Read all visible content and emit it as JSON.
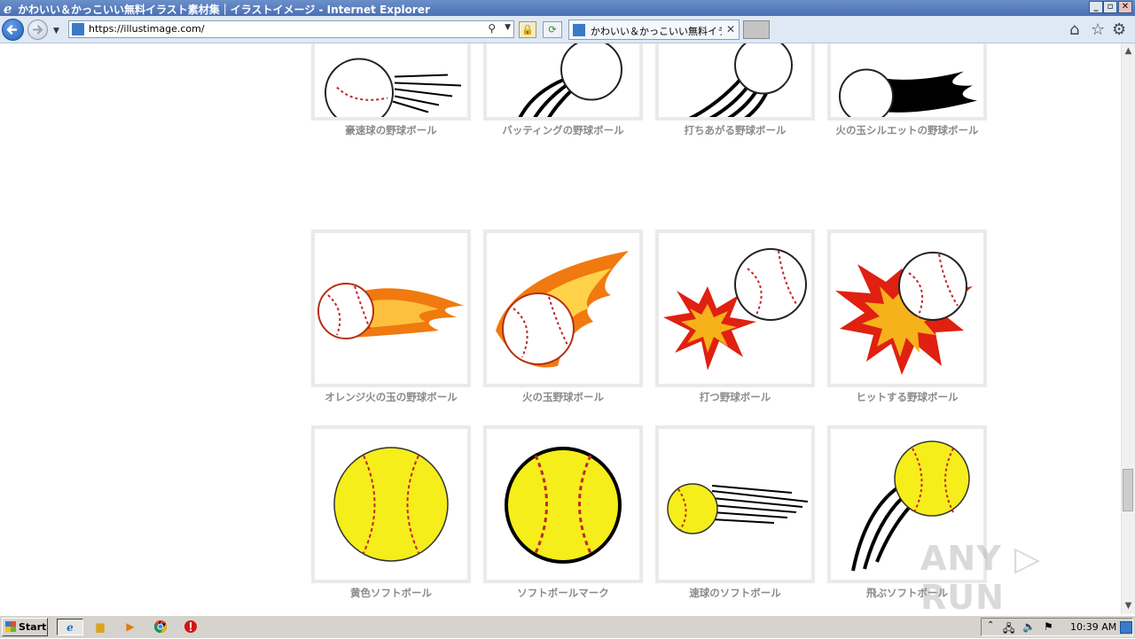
{
  "window": {
    "title": "かわいい＆かっこいい無料イラスト素材集｜イラストイメージ - Internet Explorer",
    "minimize_glyph": "_",
    "restore_glyph": "▫",
    "close_glyph": "✕"
  },
  "address_bar": {
    "url": "https://illustimage.com/"
  },
  "tab": {
    "label": "かわいい＆かっこいい無料イラ...",
    "close_glyph": "✕"
  },
  "toolbar_icons": [
    "home-icon",
    "favorites-star-icon",
    "gear-icon"
  ],
  "cards": [
    {
      "caption": "豪速球の野球ボール"
    },
    {
      "caption": "バッティングの野球ボール"
    },
    {
      "caption": "打ちあがる野球ボール"
    },
    {
      "caption": "火の玉シルエットの野球ボール"
    },
    {
      "caption": "オレンジ火の玉の野球ボール"
    },
    {
      "caption": "火の玉野球ボール"
    },
    {
      "caption": "打つ野球ボール"
    },
    {
      "caption": "ヒットする野球ボール"
    },
    {
      "caption": "黄色ソフトボール"
    },
    {
      "caption": "ソフトボールマーク"
    },
    {
      "caption": "速球のソフトボール"
    },
    {
      "caption": "飛ぶソフトボール"
    }
  ],
  "watermark": "ANY ▷ RUN",
  "taskbar": {
    "start_label": "Start",
    "clock": "10:39 AM",
    "pinned": [
      "internet-explorer-icon",
      "folder-icon",
      "media-player-icon",
      "chrome-icon",
      "stop-icon"
    ]
  },
  "colors": {
    "title_bar": "#4a70b5",
    "card_border": "#eaeaea",
    "caption_text": "#8a8a8a",
    "softball_yellow": "#f5ee1a",
    "fire_orange": "#f07a10",
    "explosion_red": "#e02010"
  }
}
